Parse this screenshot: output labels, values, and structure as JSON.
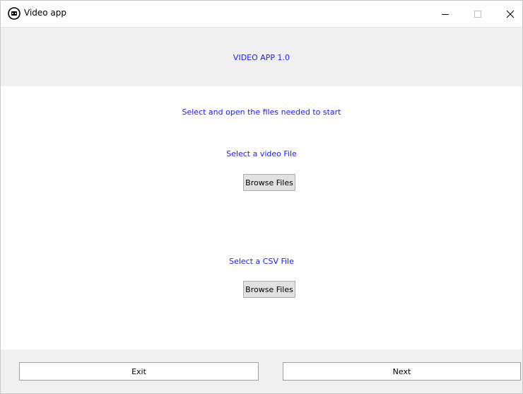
{
  "window": {
    "title": "Video app",
    "icon": "video-app-icon"
  },
  "header": {
    "title": "VIDEO APP 1.0"
  },
  "main": {
    "instructions": "Select and open the files needed to start",
    "video_section": {
      "label": "Select a video File",
      "button_label": "Browse Files"
    },
    "csv_section": {
      "label": "Select a CSV File",
      "button_label": "Browse Files"
    }
  },
  "footer": {
    "exit_label": "Exit",
    "next_label": "Next"
  },
  "colors": {
    "accent_text": "#1a1aff",
    "panel_bg": "#f0f0f0"
  }
}
